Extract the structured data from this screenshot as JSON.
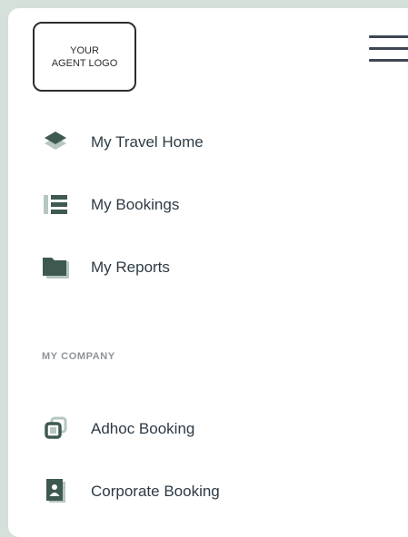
{
  "logo": {
    "line1": "YOUR",
    "line2": "AGENT LOGO"
  },
  "nav": {
    "items": [
      {
        "label": "My Travel Home",
        "icon": "layers-icon"
      },
      {
        "label": "My Bookings",
        "icon": "list-icon"
      },
      {
        "label": "My Reports",
        "icon": "folder-icon"
      }
    ]
  },
  "company": {
    "section_label": "MY COMPANY",
    "items": [
      {
        "label": "Adhoc Booking",
        "icon": "copy-icon"
      },
      {
        "label": "Corporate Booking",
        "icon": "contact-card-icon"
      }
    ]
  },
  "colors": {
    "background": "#d4e0d9",
    "icon_primary": "#3e5a50",
    "icon_secondary": "#b7c6be",
    "text": "#2e3b44",
    "section_label": "#8e9499"
  }
}
